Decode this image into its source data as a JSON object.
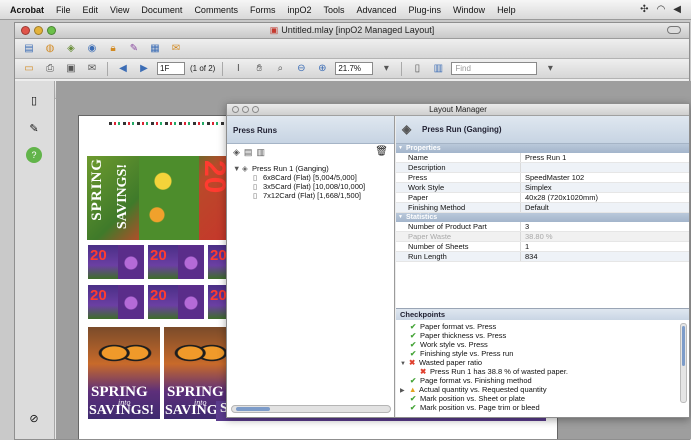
{
  "menubar": {
    "items": [
      "Acrobat",
      "File",
      "Edit",
      "View",
      "Document",
      "Comments",
      "Forms",
      "inpO2",
      "Tools",
      "Advanced",
      "Plug-ins",
      "Window",
      "Help"
    ]
  },
  "window": {
    "title": "Untitled.mlay [inpO2 Managed Layout]"
  },
  "toolbar": {
    "page_value": "1F",
    "page_of": "(1 of 2)",
    "zoom_value": "21.7%",
    "find_placeholder": "Find"
  },
  "document": {
    "poster_headline": "SPRING",
    "poster_into": "into",
    "poster_savings": "SAVINGS!",
    "poster_number": "20",
    "savings_repeat": [
      "SAVINGS!",
      "SAVINGS!",
      "SAVINGS!",
      "SAVINGS!"
    ]
  },
  "layout_manager": {
    "title": "Layout Manager",
    "press_runs_header": "Press Runs",
    "tree": [
      {
        "label": "Press Run 1 (Ganging)",
        "level": 0
      },
      {
        "label": "6x8Card (Flat) [5,004/5,000]",
        "level": 1
      },
      {
        "label": "3x5Card (Flat) [10,008/10,000]",
        "level": 1
      },
      {
        "label": "7x12Card (Flat) [1,668/1,500]",
        "level": 1
      }
    ],
    "detail_header": "Press Run (Ganging)",
    "properties_label": "Properties",
    "properties": [
      {
        "key": "Name",
        "value": "Press Run 1"
      },
      {
        "key": "Description",
        "value": ""
      },
      {
        "key": "Press",
        "value": "SpeedMaster 102"
      },
      {
        "key": "Work Style",
        "value": "Simplex"
      },
      {
        "key": "Paper",
        "value": "40x28 (720x1020mm)"
      },
      {
        "key": "Finishing Method",
        "value": "Default"
      }
    ],
    "statistics_label": "Statistics",
    "statistics": [
      {
        "key": "Number of Product Part",
        "value": "3",
        "dim": false
      },
      {
        "key": "Paper Waste",
        "value": "38.80 %",
        "dim": true
      },
      {
        "key": "Number of Sheets",
        "value": "1",
        "dim": false
      },
      {
        "key": "Run Length",
        "value": "834",
        "dim": false
      }
    ],
    "checkpoints_label": "Checkpoints",
    "checkpoints": [
      {
        "label": "Paper format vs. Press",
        "status": "ok",
        "indent": 1,
        "expander": ""
      },
      {
        "label": "Paper thickness vs. Press",
        "status": "ok",
        "indent": 1,
        "expander": ""
      },
      {
        "label": "Work style vs. Press",
        "status": "ok",
        "indent": 1,
        "expander": ""
      },
      {
        "label": "Finishing style vs. Press run",
        "status": "ok",
        "indent": 1,
        "expander": ""
      },
      {
        "label": "Wasted paper ratio",
        "status": "bad",
        "indent": 0,
        "expander": "▼"
      },
      {
        "label": "Press Run 1 has 38.8 % of wasted paper.",
        "status": "bad",
        "indent": 2,
        "expander": ""
      },
      {
        "label": "Page format vs. Finishing method",
        "status": "ok",
        "indent": 1,
        "expander": ""
      },
      {
        "label": "Actual quantity vs. Requested quantity",
        "status": "warn",
        "indent": 0,
        "expander": "▶"
      },
      {
        "label": "Mark position vs. Sheet or plate",
        "status": "ok",
        "indent": 1,
        "expander": ""
      },
      {
        "label": "Mark position vs. Page trim or bleed",
        "status": "ok",
        "indent": 1,
        "expander": ""
      }
    ]
  }
}
